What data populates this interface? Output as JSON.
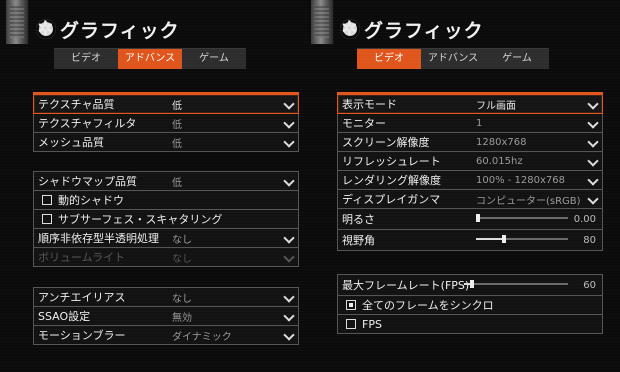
{
  "left": {
    "title": "グラフィック",
    "tabs": [
      {
        "label": "ビデオ",
        "active": false
      },
      {
        "label": "アドバンス",
        "active": true
      },
      {
        "label": "ゲーム",
        "active": false
      }
    ],
    "groups": [
      [
        {
          "type": "dropdown",
          "label": "テクスチャ品質",
          "value": "低",
          "highlight": true
        },
        {
          "type": "dropdown",
          "label": "テクスチャフィルタ",
          "value": "低"
        },
        {
          "type": "dropdown",
          "label": "メッシュ品質",
          "value": "低"
        }
      ],
      [
        {
          "type": "dropdown",
          "label": "シャドウマップ品質",
          "value": "低"
        },
        {
          "type": "checkbox",
          "label": "動的シャドウ",
          "checked": false
        },
        {
          "type": "checkbox",
          "label": "サブサーフェス・スキャタリング",
          "checked": false
        },
        {
          "type": "dropdown",
          "label": "順序非依存型半透明処理",
          "value": "なし"
        },
        {
          "type": "dropdown",
          "label": "ボリュームライト",
          "value": "なし",
          "disabled": true
        }
      ],
      [
        {
          "type": "dropdown",
          "label": "アンチエイリアス",
          "value": "なし"
        },
        {
          "type": "dropdown",
          "label": "SSAO設定",
          "value": "無効"
        },
        {
          "type": "dropdown",
          "label": "モーションブラー",
          "value": "ダイナミック"
        }
      ]
    ]
  },
  "right": {
    "title": "グラフィック",
    "tabs": [
      {
        "label": "ビデオ",
        "active": true
      },
      {
        "label": "アドバンス",
        "active": false
      },
      {
        "label": "ゲーム",
        "active": false
      }
    ],
    "groups": [
      [
        {
          "type": "dropdown",
          "label": "表示モード",
          "value": "フル画面",
          "highlight": true
        },
        {
          "type": "dropdown",
          "label": "モニター",
          "value": "1"
        },
        {
          "type": "dropdown",
          "label": "スクリーン解像度",
          "value": "1280x768"
        },
        {
          "type": "dropdown",
          "label": "リフレッシュレート",
          "value": "60.015hz"
        },
        {
          "type": "dropdown",
          "label": "レンダリング解像度",
          "value": "100% - 1280x768"
        },
        {
          "type": "dropdown",
          "label": "ディスプレイガンマ",
          "value": "コンピューター(sRGB)"
        },
        {
          "type": "slider",
          "label": "明るさ",
          "value": "0.00",
          "fraction": 0.0
        },
        {
          "type": "slider",
          "label": "視野角",
          "value": "80",
          "fraction": 0.3
        }
      ],
      [
        {
          "type": "slider",
          "label": "最大フレームレート(FPS)",
          "value": "60",
          "fraction": 0.08
        },
        {
          "type": "checkbox",
          "label": "全てのフレームをシンクロ",
          "checked": true
        },
        {
          "type": "checkbox",
          "label": "FPS",
          "checked": false
        }
      ]
    ]
  },
  "colors": {
    "accent": "#e2561c",
    "background": "#0b0b0c"
  },
  "icons": {
    "header": "gear-icon",
    "dropdown": "chevron-down-icon"
  }
}
